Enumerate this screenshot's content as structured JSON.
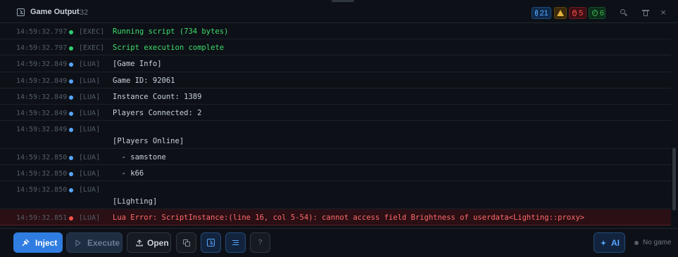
{
  "header": {
    "title": "Game Output",
    "count": "32",
    "badges": {
      "info": "21",
      "errors": "5",
      "success": "6"
    }
  },
  "log": [
    {
      "time": "14:59:32.797",
      "source": "[EXEC]",
      "level": "exec",
      "message": "Running script (734 bytes)"
    },
    {
      "time": "14:59:32.797",
      "source": "[EXEC]",
      "level": "exec",
      "message": "Script execution complete"
    },
    {
      "time": "14:59:32.849",
      "source": "[LUA]",
      "level": "lua",
      "message": "[Game Info]"
    },
    {
      "time": "14:59:32.849",
      "source": "[LUA]",
      "level": "lua",
      "message": "Game ID: 92061"
    },
    {
      "time": "14:59:32.849",
      "source": "[LUA]",
      "level": "lua",
      "message": "Instance Count: 1389"
    },
    {
      "time": "14:59:32.849",
      "source": "[LUA]",
      "level": "lua",
      "message": "Players Connected: 2"
    },
    {
      "time": "14:59:32.849",
      "source": "[LUA]",
      "level": "lua",
      "message": "[Players Online]"
    },
    {
      "time": "14:59:32.850",
      "source": "[LUA]",
      "level": "lua",
      "message": "  - samstone"
    },
    {
      "time": "14:59:32.850",
      "source": "[LUA]",
      "level": "lua",
      "message": "  - k66"
    },
    {
      "time": "14:59:32.850",
      "source": "[LUA]",
      "level": "lua",
      "message": "[Lighting]"
    },
    {
      "time": "14:59:32.851",
      "source": "[LUA]",
      "level": "error",
      "message": "Lua Error: ScriptInstance:(line 16, col 5-54): cannot access field Brightness of userdata<Lighting::proxy>"
    }
  ],
  "toolbar": {
    "inject_label": "Inject",
    "execute_label": "Execute",
    "open_label": "Open",
    "help_label": "?",
    "ai_label": "AI",
    "status_text": "No game"
  },
  "colors": {
    "exec_dot": "#2ecc71",
    "lua_dot": "#58a6ff",
    "error_dot": "#f85149",
    "accent": "#2f7de1"
  }
}
